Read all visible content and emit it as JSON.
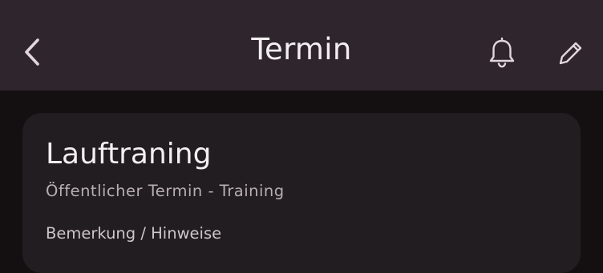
{
  "appbar": {
    "title": "Termin",
    "back_icon": "chevron-left-icon",
    "notification_icon": "bell-icon",
    "edit_icon": "pencil-icon"
  },
  "event": {
    "title": "Lauftraning",
    "subtitle": "Öffentlicher Termin - Training",
    "next_line_partial": "Bemerkung / Hinweise"
  },
  "colors": {
    "appbar_bg": "#2e262c",
    "page_bg": "#141011",
    "card_bg": "#221d20",
    "icon": "#e2d6dc"
  }
}
